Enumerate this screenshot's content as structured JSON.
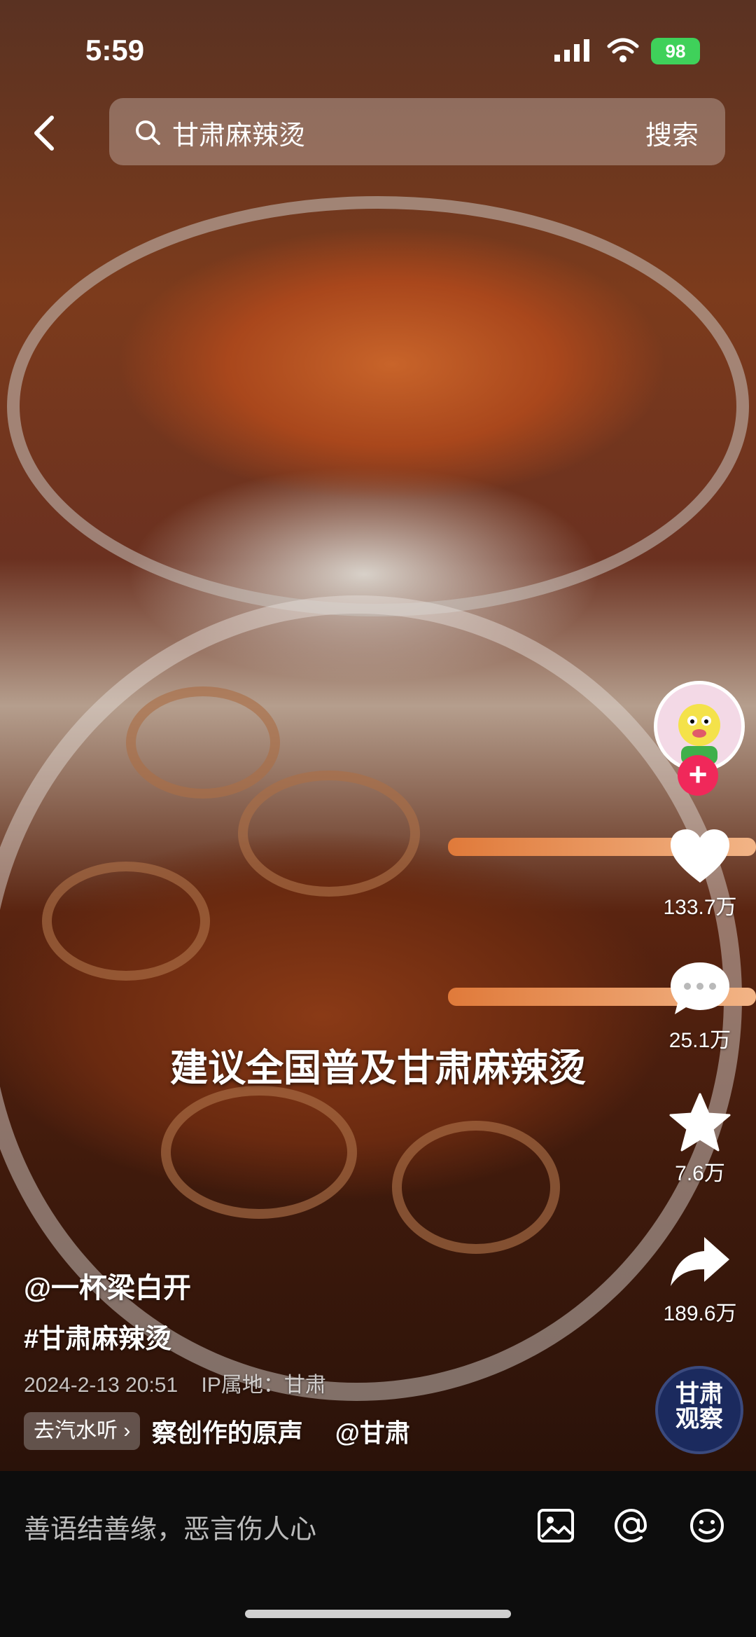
{
  "status_bar": {
    "time": "5:59",
    "battery": "98"
  },
  "search": {
    "query": "甘肃麻辣烫",
    "button_label": "搜索"
  },
  "video": {
    "caption_overlay": "建议全国普及甘肃麻辣烫"
  },
  "actions": {
    "likes": "133.7万",
    "comments": "25.1万",
    "favorites": "7.6万",
    "shares": "189.6万"
  },
  "music_disc": {
    "text_line1": "甘肃",
    "text_line2": "观察"
  },
  "post": {
    "author": "@一杯梁白开",
    "hashtag": "#甘肃麻辣烫",
    "date": "2024-2-13 20:51",
    "ip_location": "IP属地：甘肃",
    "music_chip": "去汽水听",
    "music_chip_arrow": "›",
    "music_text": "察创作的原声　 @甘肃"
  },
  "comment_bar": {
    "placeholder": "善语结善缘，恶言伤人心"
  },
  "icons": [
    "back-icon",
    "search-icon",
    "signal-icon",
    "wifi-icon",
    "battery-icon",
    "heart-icon",
    "comment-icon",
    "star-icon",
    "share-icon",
    "image-icon",
    "at-icon",
    "emoji-icon",
    "plus-icon"
  ]
}
